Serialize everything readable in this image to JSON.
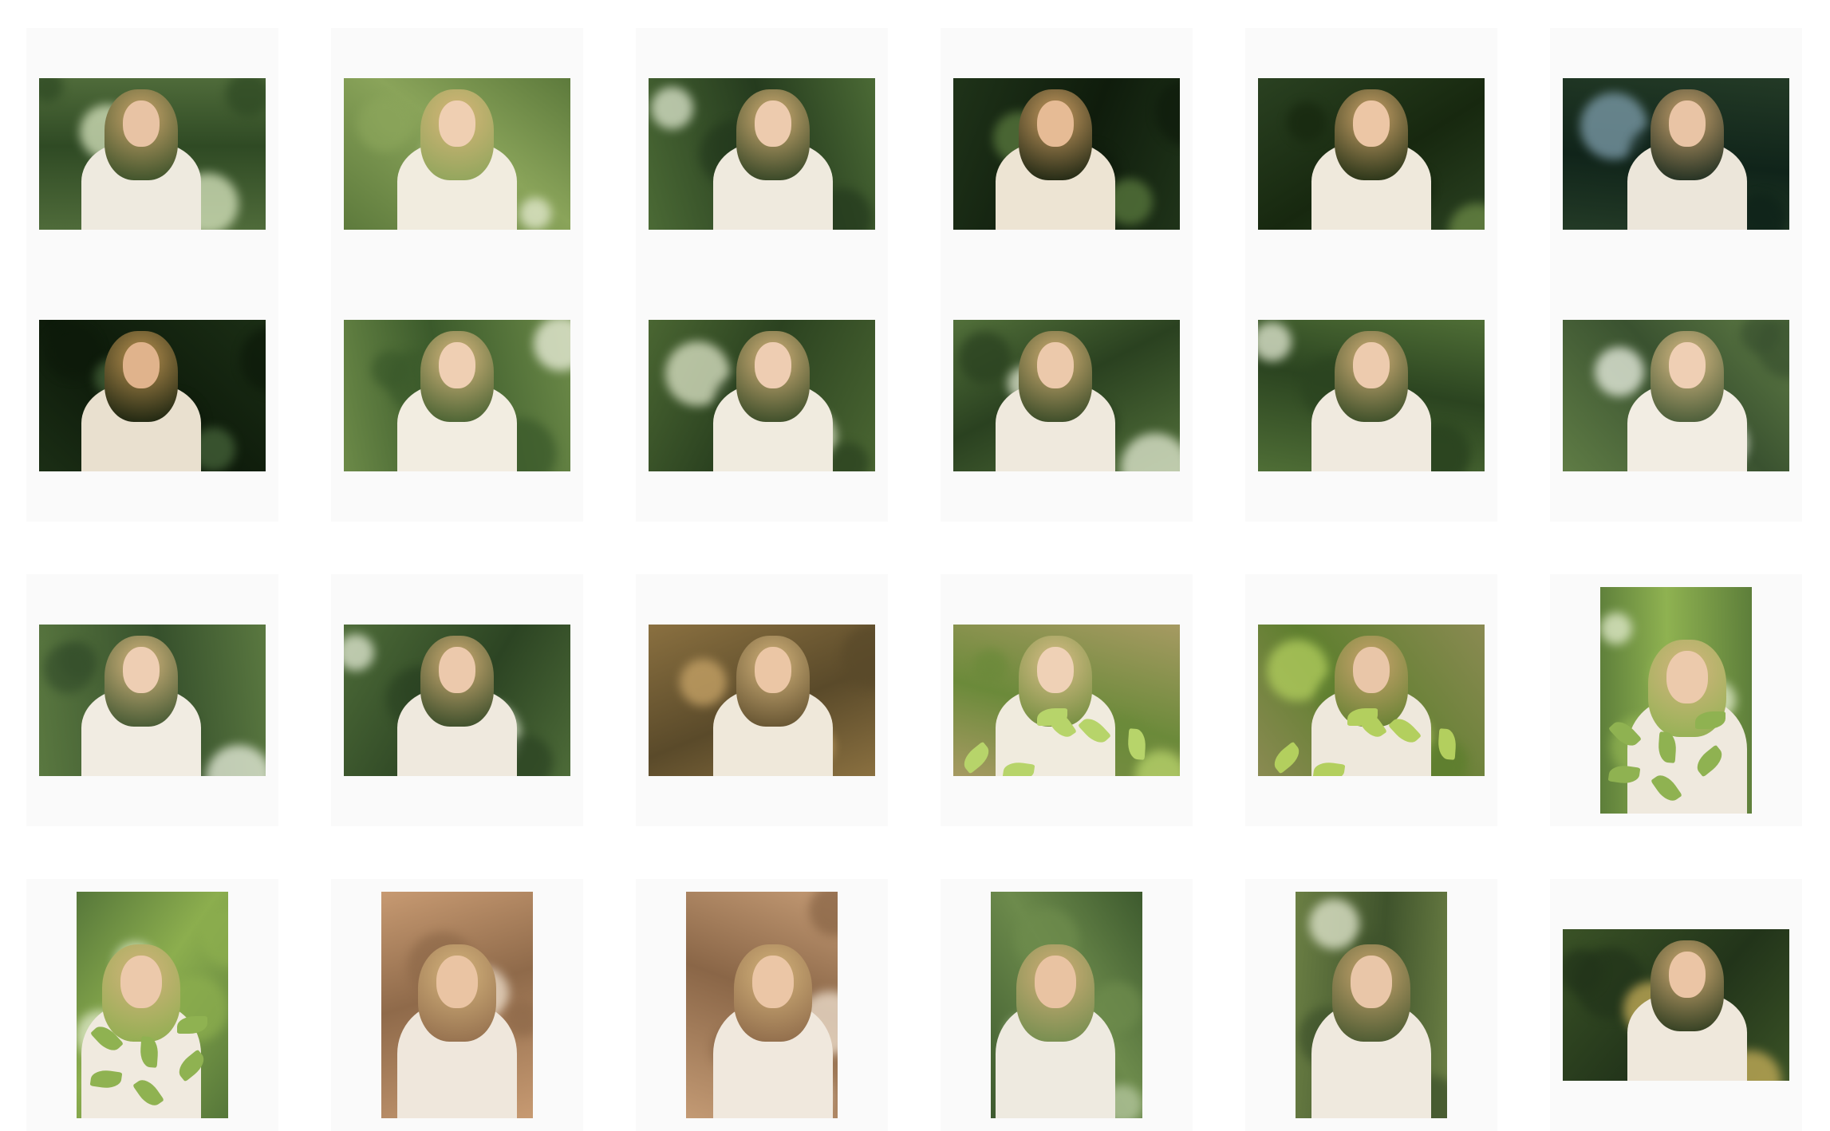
{
  "gallery": {
    "photos": [
      {
        "orientation": "landscape",
        "palette": {
          "bg": "#4f6b3a",
          "alt": "#2f4a24",
          "light": "#d9e6c0",
          "hair": "#c9a46a",
          "face": "#e8c3a4",
          "shirt": "#eeeadf"
        }
      },
      {
        "orientation": "landscape",
        "palette": {
          "bg": "#5d7a3c",
          "alt": "#8aa45a",
          "light": "#e6ecd2",
          "hair": "#d6b577",
          "face": "#efcfb2",
          "shirt": "#f1ecdf"
        }
      },
      {
        "orientation": "landscape",
        "palette": {
          "bg": "#4b6a35",
          "alt": "#253b1e",
          "light": "#dfe8cf",
          "hair": "#d1ad73",
          "face": "#edcbae",
          "shirt": "#efeade"
        }
      },
      {
        "orientation": "landscape",
        "palette": {
          "bg": "#1f3319",
          "alt": "#0f1c0c",
          "light": "#5a7a3e",
          "hair": "#c79a5f",
          "face": "#e6bb95",
          "shirt": "#ede4d3"
        }
      },
      {
        "orientation": "landscape",
        "palette": {
          "bg": "#2a4121",
          "alt": "#17280f",
          "light": "#6c8a46",
          "hair": "#caa268",
          "face": "#ecc6a5",
          "shirt": "#efe9dc"
        }
      },
      {
        "orientation": "landscape",
        "palette": {
          "bg": "#233a26",
          "alt": "#10241a",
          "light": "#7f9fae",
          "hair": "#c6a06c",
          "face": "#e9c4a5",
          "shirt": "#ece6da"
        }
      },
      {
        "orientation": "landscape",
        "palette": {
          "bg": "#1b2e15",
          "alt": "#0d1a0a",
          "light": "#46643a",
          "hair": "#b8904f",
          "face": "#e0b38c",
          "shirt": "#e9e0cf"
        }
      },
      {
        "orientation": "landscape",
        "palette": {
          "bg": "#6c8a48",
          "alt": "#3b5a2b",
          "light": "#eef1de",
          "hair": "#d6b67d",
          "face": "#efcfb3",
          "shirt": "#f2ede1"
        }
      },
      {
        "orientation": "landscape",
        "palette": {
          "bg": "#4a6632",
          "alt": "#2b4220",
          "light": "#dfe6c9",
          "hair": "#d3b179",
          "face": "#eecdb2",
          "shirt": "#f0ebdf"
        }
      },
      {
        "orientation": "landscape",
        "palette": {
          "bg": "#52703a",
          "alt": "#2a4120",
          "light": "#e3ead3",
          "hair": "#d1ae73",
          "face": "#ecc9ab",
          "shirt": "#efe9dd"
        }
      },
      {
        "orientation": "landscape",
        "palette": {
          "bg": "#4f6e36",
          "alt": "#2b4420",
          "light": "#e6ecd6",
          "hair": "#d2af77",
          "face": "#edcbae",
          "shirt": "#f0eadf"
        }
      },
      {
        "orientation": "landscape",
        "palette": {
          "bg": "#5f7c45",
          "alt": "#3a5230",
          "light": "#eef3e6",
          "hair": "#d7b983",
          "face": "#efcfb4",
          "shirt": "#f2ede3"
        }
      },
      {
        "orientation": "landscape",
        "palette": {
          "bg": "#5a7840",
          "alt": "#36502c",
          "light": "#eaf0df",
          "hair": "#d5b57d",
          "face": "#eeceb3",
          "shirt": "#f1ece2"
        }
      },
      {
        "orientation": "landscape",
        "palette": {
          "bg": "#4d6b38",
          "alt": "#2c4423",
          "light": "#e4ebd5",
          "hair": "#d0ad74",
          "face": "#ecc9ac",
          "shirt": "#efe9de"
        }
      },
      {
        "orientation": "landscape",
        "palette": {
          "bg": "#8a7040",
          "alt": "#5a4a2a",
          "light": "#c9a568",
          "hair": "#d2b27a",
          "face": "#ebc6a5",
          "shirt": "#efe8da"
        }
      },
      {
        "orientation": "landscape",
        "palette": {
          "bg": "#a69a62",
          "alt": "#6b8a3a",
          "light": "#b7d46a",
          "hair": "#d8bd87",
          "face": "#efd1b6",
          "shirt": "#f0ebde"
        }
      },
      {
        "orientation": "landscape",
        "palette": {
          "bg": "#8a8a52",
          "alt": "#5f7f2f",
          "light": "#b3cf5e",
          "hair": "#c9a36c",
          "face": "#e9c6a8",
          "shirt": "#eee8dc"
        }
      },
      {
        "orientation": "portrait",
        "palette": {
          "bg": "#5d7e3a",
          "alt": "#8fb251",
          "light": "#e6efd0",
          "hair": "#d3b47e",
          "face": "#eccaac",
          "shirt": "#efe9de"
        }
      },
      {
        "orientation": "portrait",
        "palette": {
          "bg": "#56773a",
          "alt": "#8cae4e",
          "light": "#e3ecce",
          "hair": "#d2b27b",
          "face": "#ecc9ab",
          "shirt": "#f0eadf"
        }
      },
      {
        "orientation": "portrait",
        "palette": {
          "bg": "#c79a72",
          "alt": "#8f6a4a",
          "light": "#f1e2cf",
          "hair": "#d4b37c",
          "face": "#eac4a3",
          "shirt": "#efe7dc"
        }
      },
      {
        "orientation": "portrait",
        "palette": {
          "bg": "#c39a74",
          "alt": "#8a6647",
          "light": "#f2e4d3",
          "hair": "#d3b27a",
          "face": "#ebc6a6",
          "shirt": "#f0e8dd"
        }
      },
      {
        "orientation": "portrait",
        "palette": {
          "bg": "#3d5a2e",
          "alt": "#6d8b4c",
          "light": "#b7c9a0",
          "hair": "#d0ad76",
          "face": "#e9c3a2",
          "shirt": "#eeeae0"
        }
      },
      {
        "orientation": "portrait",
        "palette": {
          "bg": "#6b7f44",
          "alt": "#3f532c",
          "light": "#e5ead2",
          "hair": "#c9a56e",
          "face": "#e9c6a8",
          "shirt": "#efe9de"
        }
      },
      {
        "orientation": "landscape",
        "palette": {
          "bg": "#3a5226",
          "alt": "#22341a",
          "light": "#c9b05a",
          "hair": "#cfaa72",
          "face": "#ebc5a5",
          "shirt": "#efe8dc"
        }
      }
    ]
  }
}
